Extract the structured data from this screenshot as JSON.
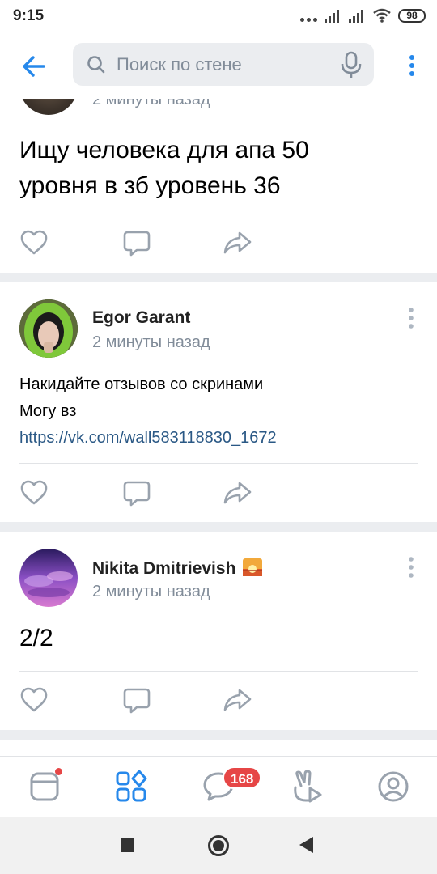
{
  "status_bar": {
    "time": "9:15",
    "battery": "98"
  },
  "header": {
    "search_placeholder": "Поиск по стене"
  },
  "posts": [
    {
      "meta": "2 минуты назад",
      "text_lines": [
        "Ищу человека для апа 50",
        "уровня в зб уровень 36"
      ]
    },
    {
      "author": "Egor Garant",
      "meta": "2 минуты назад",
      "text_lines": [
        "Накидайте отзывов со скринами",
        "Могу вз"
      ],
      "link": "https://vk.com/wall583118830_1672"
    },
    {
      "author": "Nikita Dmitrievish",
      "meta": "2 минуты назад",
      "text_lines": [
        "2/2"
      ]
    }
  ],
  "tabbar": {
    "messages_badge": "168"
  },
  "icons": {
    "back": "arrow-left-icon",
    "search": "search-icon",
    "mic": "microphone-icon",
    "menu": "more-vertical-icon",
    "like": "heart-icon",
    "comment": "comment-icon",
    "share": "share-icon",
    "tabs": [
      "newsfeed-icon",
      "services-icon",
      "messages-icon",
      "clips-icon",
      "profile-icon"
    ]
  },
  "colors": {
    "accent": "#2688eb",
    "badge": "#e64646",
    "icon_gray": "#99a2ad",
    "link": "#2a5885"
  }
}
